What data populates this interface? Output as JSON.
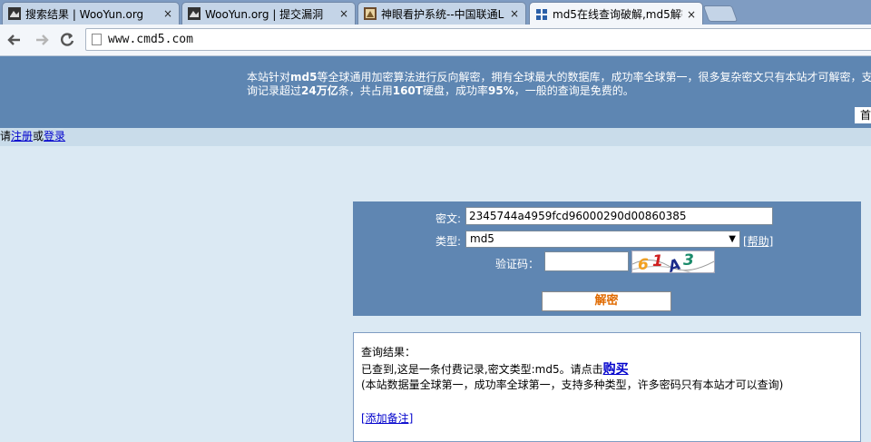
{
  "browser": {
    "tabs": [
      {
        "label": "搜索结果 | WooYun.org"
      },
      {
        "label": "WooYun.org | 提交漏洞"
      },
      {
        "label": "神眼看护系统--中国联通L"
      },
      {
        "label": "md5在线查询破解,md5解密"
      }
    ],
    "close_glyph": "×",
    "url": "www.cmd5.com"
  },
  "header": {
    "notice_line1_pre": "本站针对",
    "notice_line1_bold": "md5",
    "notice_line1_post": "等全球通用加密算法进行反向解密，拥有全球最大的数据库，成功率全球第一，很多复杂密文只有本站才可解密，支",
    "notice_line2_pre": "询记录超过",
    "notice_line2_bold1": "24万亿",
    "notice_line2_mid": "条，共占用",
    "notice_line2_bold2": "160T",
    "notice_line2_mid2": "硬盘，成功率",
    "notice_line2_bold3": "95%",
    "notice_line2_post": "，一般的查询是免费的。",
    "home_tab": "首"
  },
  "loginbar": {
    "prefix": "请",
    "register": "注册",
    "or": "或",
    "login": "登录"
  },
  "form": {
    "cipher_label": "密文:",
    "cipher_value": "2345744a4959fcd96000290d00860385",
    "type_label": "类型:",
    "type_value": "md5",
    "help_link": "[帮助]",
    "captcha_label": "验证码：",
    "captcha_value": "",
    "captcha_chars": [
      "6",
      "1",
      "A",
      "3"
    ],
    "decrypt_button": "解密"
  },
  "result": {
    "title": "查询结果：",
    "found_pre": "已查到,这是一条付费记录,密文类型:md5。请点击",
    "buy_link": "购买",
    "info": "(本站数据量全球第一，成功率全球第一，支持多种类型，许多密码只有本站才可以查询)",
    "add_note": "[添加备注]"
  }
}
